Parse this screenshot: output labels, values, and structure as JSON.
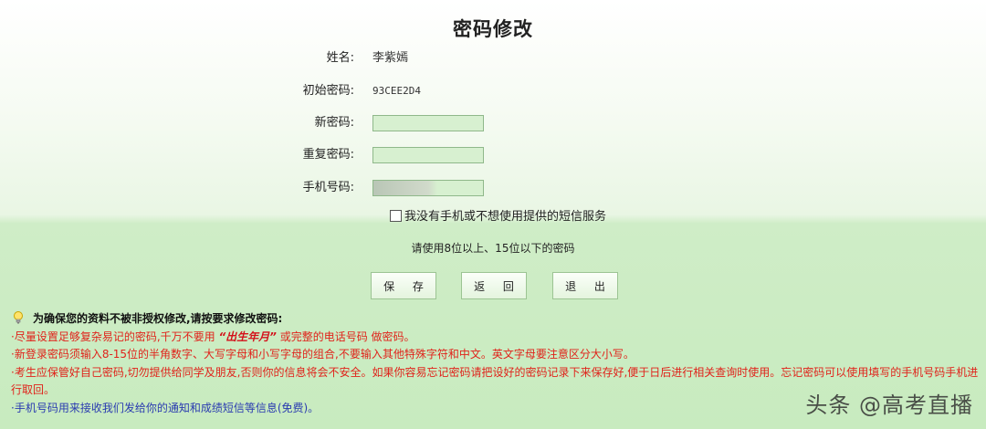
{
  "page": {
    "title": "密码修改"
  },
  "form": {
    "name_label": "姓名:",
    "name_value": "李紫嫣",
    "initial_password_label": "初始密码:",
    "initial_password_value": "93CEE2D4",
    "new_password_label": "新密码:",
    "new_password_value": "",
    "repeat_password_label": "重复密码:",
    "repeat_password_value": "",
    "phone_label": "手机号码:",
    "phone_value": "",
    "no_phone_checkbox_label": "我没有手机或不想使用提供的短信服务",
    "no_phone_checked": false,
    "password_hint": "请使用8位以上、15位以下的密码"
  },
  "buttons": {
    "save": "保 存",
    "back": "返 回",
    "exit": "退 出"
  },
  "notice": {
    "heading": "为确保您的资料不被非授权修改,请按要求修改密码:",
    "item1_pre": "·尽量设置足够复杂易记的密码,千万不要用 ",
    "item1_emph": "“出生年月”",
    "item1_post": " 或完整的电话号码 做密码。",
    "item2": "·新登录密码须输入8-15位的半角数字、大写字母和小写字母的组合,不要输入其他特殊字符和中文。英文字母要注意区分大小写。",
    "item3": "·考生应保管好自己密码,切勿提供给同学及朋友,否则你的信息将会不安全。如果你容易忘记密码请把设好的密码记录下来保存好,便于日后进行相关查询时使用。忘记密码可以使用填写的手机号码手机进行取回。",
    "item4": "·手机号码用来接收我们发给你的通知和成绩短信等信息(免费)。"
  },
  "watermark": "头条 @高考直播",
  "colors": {
    "notice_red": "#e0231b",
    "notice_blue": "#2a3bb0",
    "input_bg": "#d7f0d0"
  }
}
